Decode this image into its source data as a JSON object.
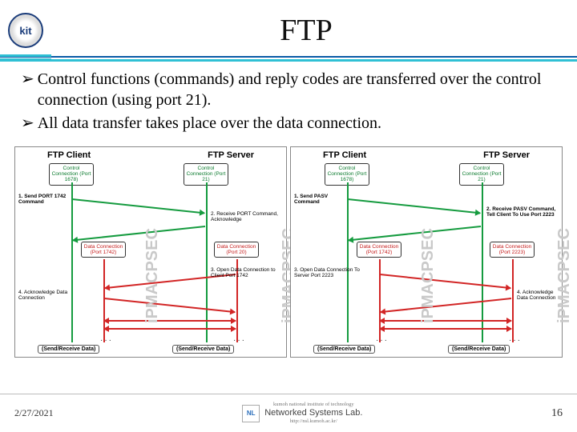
{
  "header": {
    "logo_text": "kit",
    "title": "FTP"
  },
  "bullets": [
    "Control functions (commands) and reply codes are transferred over the control connection (using port 21).",
    "All data transfer takes place over the data connection."
  ],
  "diagram": {
    "left": {
      "client_label": "FTP Client",
      "server_label": "FTP Server",
      "client_control_box": "Control Connection (Port 1678)",
      "server_control_box": "Control Connection (Port 21)",
      "client_data_box": "Data Connection (Port 1742)",
      "server_data_box": "Data Connection (Port 20)",
      "steps": {
        "s1": "1. Send PORT 1742 Command",
        "s2": "2. Receive PORT Command, Acknowledge",
        "s3": "3. Open Data Connection to Client Port 1742",
        "s4": "4. Acknowledge Data Connection"
      },
      "sendrecv_l": "(Send/Receive Data)",
      "sendrecv_r": "(Send/Receive Data)"
    },
    "right": {
      "client_label": "FTP Client",
      "server_label": "FTP Server",
      "client_control_box": "Control Connection (Port 1678)",
      "server_control_box": "Control Connection (Port 21)",
      "client_data_box": "Data Connection (Port 1742)",
      "server_data_box": "Data Connection (Port 2223)",
      "steps": {
        "s1": "1. Send PASV Command",
        "s2": "2. Receive PASV Command, Tell Client To Use Port 2223",
        "s3": "3. Open Data Connection To Server Port 2223",
        "s4": "4. Acknowledge Data Connection"
      },
      "sendrecv_l": "(Send/Receive Data)",
      "sendrecv_r": "(Send/Receive Data)"
    },
    "watermark": "iPMACPSEC"
  },
  "footer": {
    "date": "2/27/2021",
    "inst": "kumoh national institute of technology",
    "lab": "Networked Systems Lab.",
    "url": "http://nsl.kumoh.ac.kr/",
    "logo": "NL",
    "page": "16"
  }
}
